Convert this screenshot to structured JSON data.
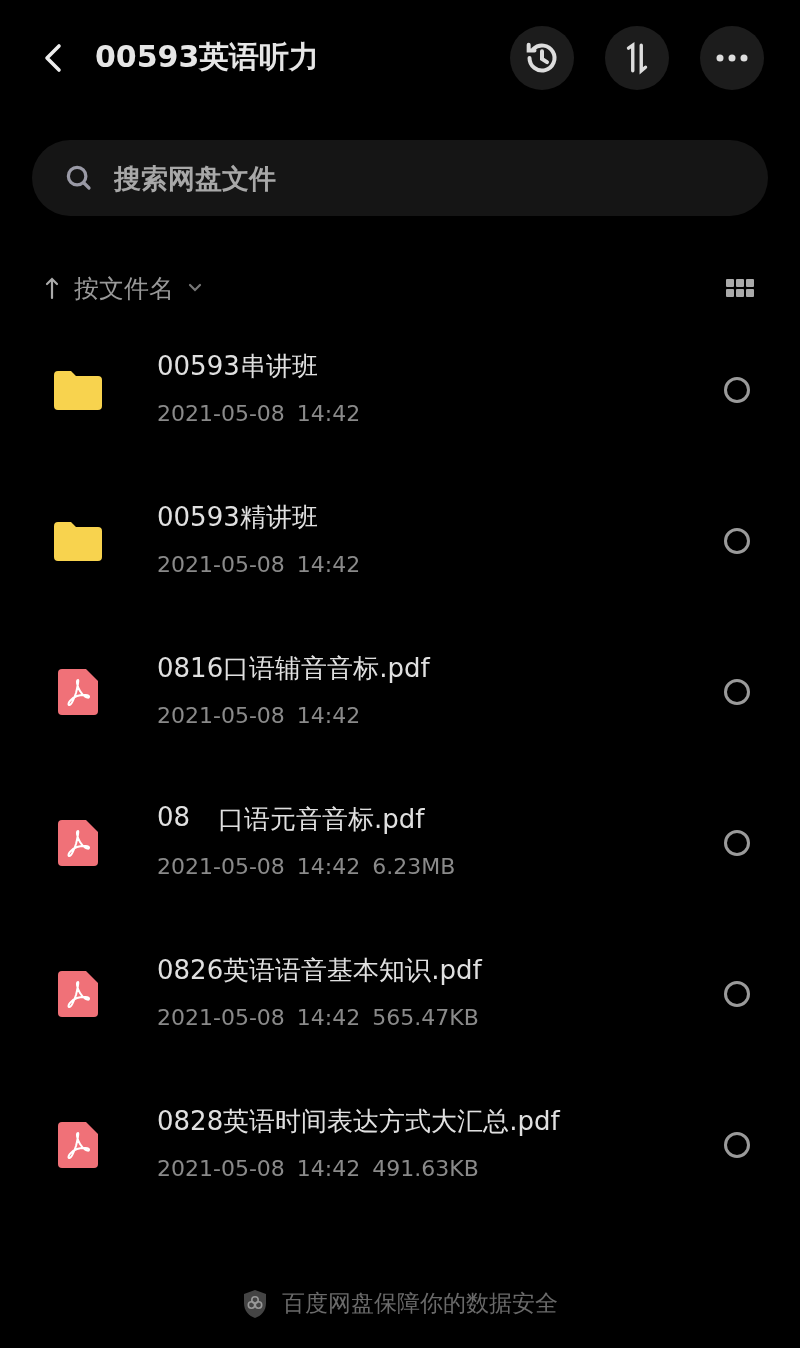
{
  "header": {
    "title": "00593英语听力",
    "actions": [
      {
        "kind": "history"
      },
      {
        "kind": "sort"
      },
      {
        "kind": "more"
      }
    ]
  },
  "search": {
    "placeholder": "搜索网盘文件"
  },
  "sort": {
    "label": "按文件名"
  },
  "files": [
    {
      "kind": "folder",
      "name": "00593串讲班",
      "date": "2021-05-08",
      "time": "14:42",
      "selected": false
    },
    {
      "kind": "folder",
      "name": "00593精讲班",
      "date": "2021-05-08",
      "time": "14:42",
      "selected": false
    },
    {
      "kind": "pdf",
      "name": "0816口语辅音音标.pdf",
      "date": "2021-05-08",
      "time": "14:42",
      "selected": false
    },
    {
      "kind": "pdf",
      "name": "08",
      "name_tail": "口语元音音标.pdf",
      "date": "2021-05-08",
      "time": "14:42",
      "size": "6.23MB",
      "selected": false
    },
    {
      "kind": "pdf",
      "name": "0826英语语音基本知识.pdf",
      "date": "2021-05-08",
      "time": "14:42",
      "size": "565.47KB",
      "selected": false
    },
    {
      "kind": "pdf",
      "name": "0828英语时间表达方式大汇总.pdf",
      "date": "2021-05-08",
      "time": "14:42",
      "size": "491.63KB",
      "selected": false
    }
  ],
  "footer": {
    "text": "百度网盘保障你的数据安全"
  }
}
